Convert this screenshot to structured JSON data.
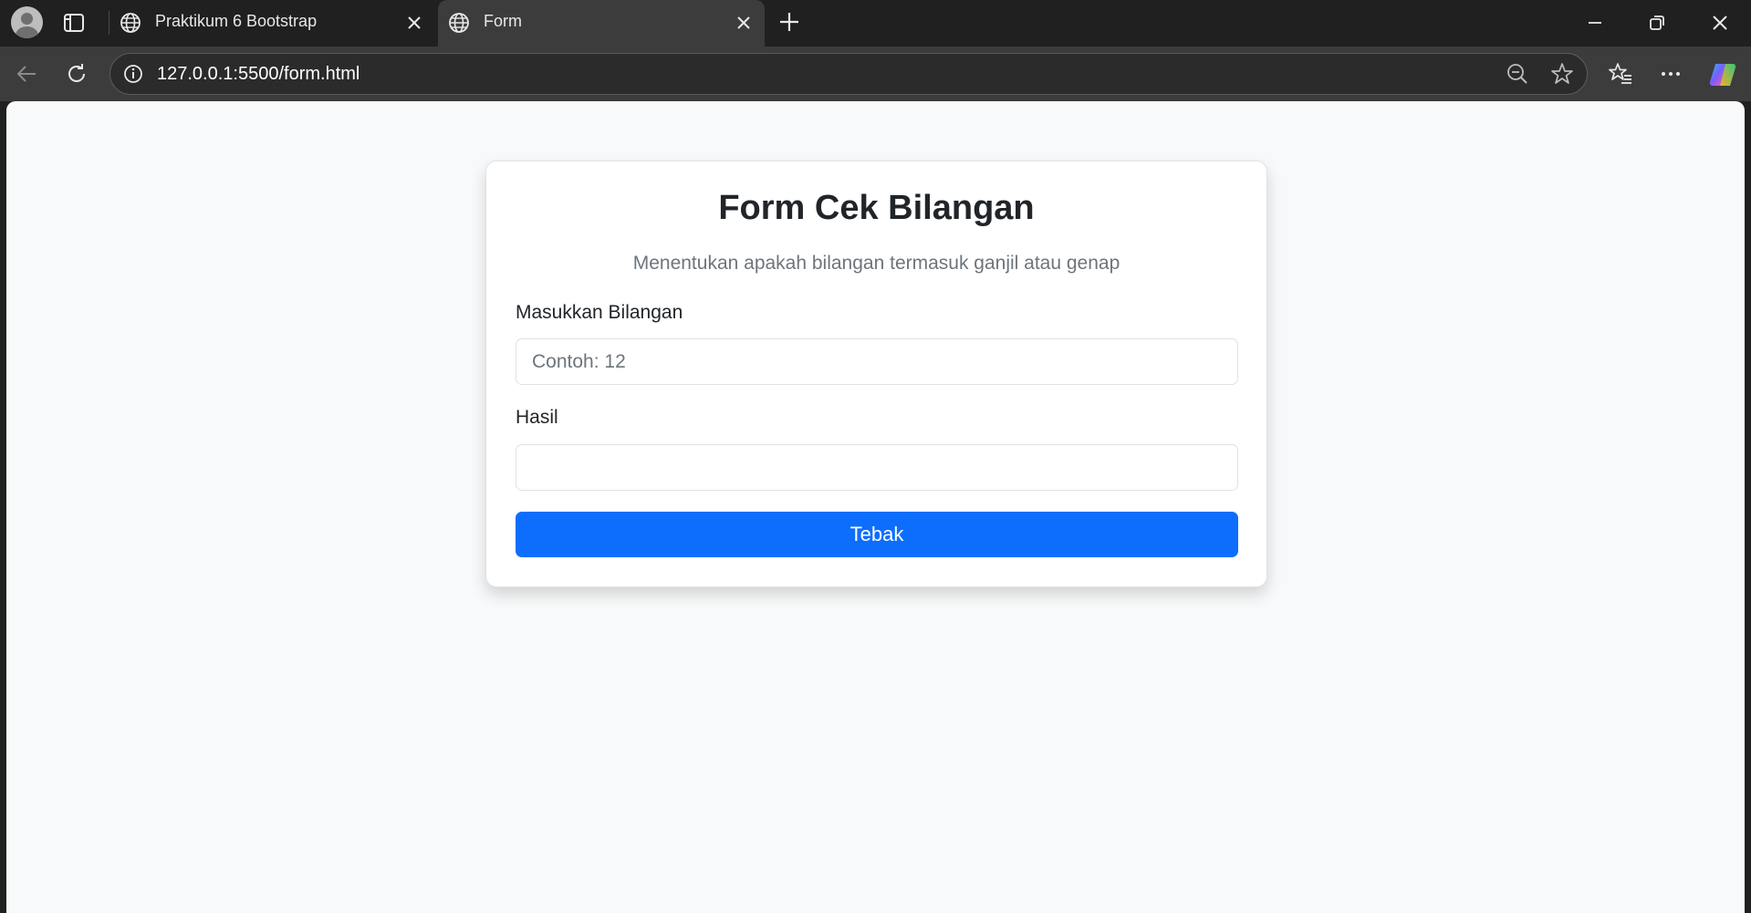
{
  "browser": {
    "tabs": [
      {
        "title": "Praktikum 6 Bootstrap",
        "active": false
      },
      {
        "title": "Form",
        "active": true
      }
    ],
    "address_bar": {
      "url": "127.0.0.1:5500/form.html"
    },
    "icons": [
      "profile-icon",
      "tab-actions-icon",
      "globe-icon",
      "close-icon",
      "new-tab-icon",
      "minimize-icon",
      "restore-icon",
      "back-icon",
      "reload-icon",
      "site-info-icon",
      "zoom-out-icon",
      "favorite-star-icon",
      "favorites-icon",
      "more-icon",
      "copilot-icon"
    ]
  },
  "page": {
    "title": "Form Cek Bilangan",
    "subtitle": "Menentukan apakah bilangan termasuk ganjil atau genap",
    "number_field": {
      "label": "Masukkan Bilangan",
      "placeholder": "Contoh: 12",
      "value": ""
    },
    "result_field": {
      "label": "Hasil",
      "value": ""
    },
    "submit_label": "Tebak",
    "colors": {
      "primary": "#0d6efd",
      "page_bg": "#f8f9fa",
      "card_bg": "#ffffff"
    }
  }
}
